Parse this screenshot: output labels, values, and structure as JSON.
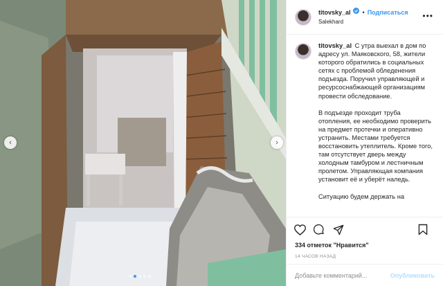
{
  "post": {
    "username": "titovsky_al",
    "verified_icon": "verified-badge-icon",
    "separator": "•",
    "follow_label": "Подписаться",
    "location": "Salekhard",
    "more_icon": "more-dots-icon",
    "caption": {
      "username": "titovsky_al",
      "paragraphs": [
        "С утра выехал в дом по адресу ул. Маяковского, 58, жители которого обратились в социальных сетях с проблемой обледенения подъезда. Поручил управляющей и ресурсоснабжающей организациям провести обследование.",
        "В подъезде проходит труба отопления, ее необходимо проверить на предмет протечки и оперативно устранить. Местами требуется восстановить утеплитель. Кроме того, там отсутствует дверь между холодным тамбуром и лестничным пролетом. Управляющая компания установит её и уберёт наледь.",
        "Ситуацию будем держать на"
      ]
    },
    "likes": "334 отметок \"Нравится\"",
    "time": "14 ЧАСОВ НАЗАД",
    "comment_placeholder": "Добавьте комментарий...",
    "publish_label": "Опубликовать",
    "carousel": {
      "slides": 5,
      "active_index": 1
    },
    "colors": {
      "accent": "#3897f0",
      "publish_disabled": "#b2dffc",
      "muted": "#8e8e8e"
    }
  }
}
